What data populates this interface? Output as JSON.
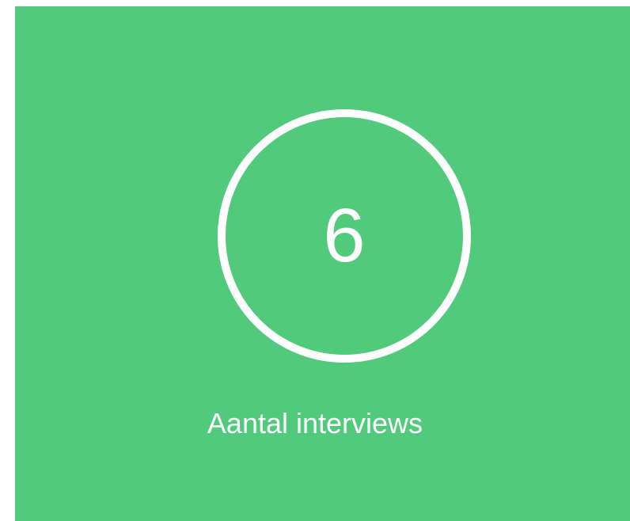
{
  "card": {
    "value": "6",
    "label": "Aantal interviews",
    "background_color": "#51ca7c",
    "ring_color": "#ffffff",
    "text_color": "#ffffff"
  }
}
